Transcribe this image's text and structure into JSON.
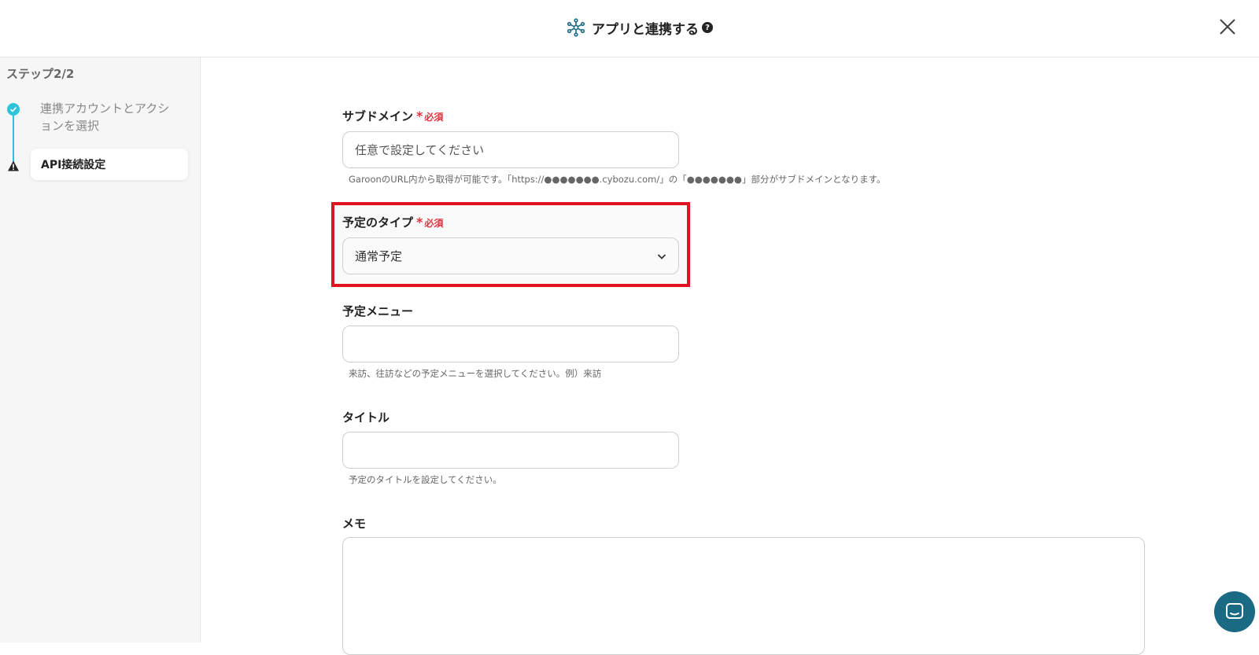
{
  "header": {
    "title": "アプリと連携する",
    "help_symbol": "?",
    "app_icon": "network-icon",
    "close_icon": "close-icon"
  },
  "sidebar": {
    "step_title": "ステップ2/2",
    "steps": [
      {
        "label": "連携アカウントとアクションを選択",
        "status": "done"
      },
      {
        "label": "API接続設定",
        "status": "warning"
      }
    ]
  },
  "form": {
    "required_label": "必須",
    "required_star": "*",
    "subdomain": {
      "label": "サブドメイン",
      "placeholder": "任意で設定してください",
      "hint": "GaroonのURL内から取得が可能です。「https://●●●●●●●.cybozu.com/」の「●●●●●●●」部分がサブドメインとなります。"
    },
    "event_type": {
      "label": "予定のタイプ",
      "selected": "通常予定"
    },
    "event_menu": {
      "label": "予定メニュー",
      "value": "",
      "hint": "来訪、往訪などの予定メニューを選択してください。例）来訪"
    },
    "title": {
      "label": "タイトル",
      "value": "",
      "hint": "予定のタイトルを設定してください。"
    },
    "memo": {
      "label": "メモ",
      "value": ""
    }
  },
  "colors": {
    "accent": "#2cc4d9",
    "required": "#e0303e",
    "highlight": "#e0141e",
    "chat": "#1a6a84"
  }
}
